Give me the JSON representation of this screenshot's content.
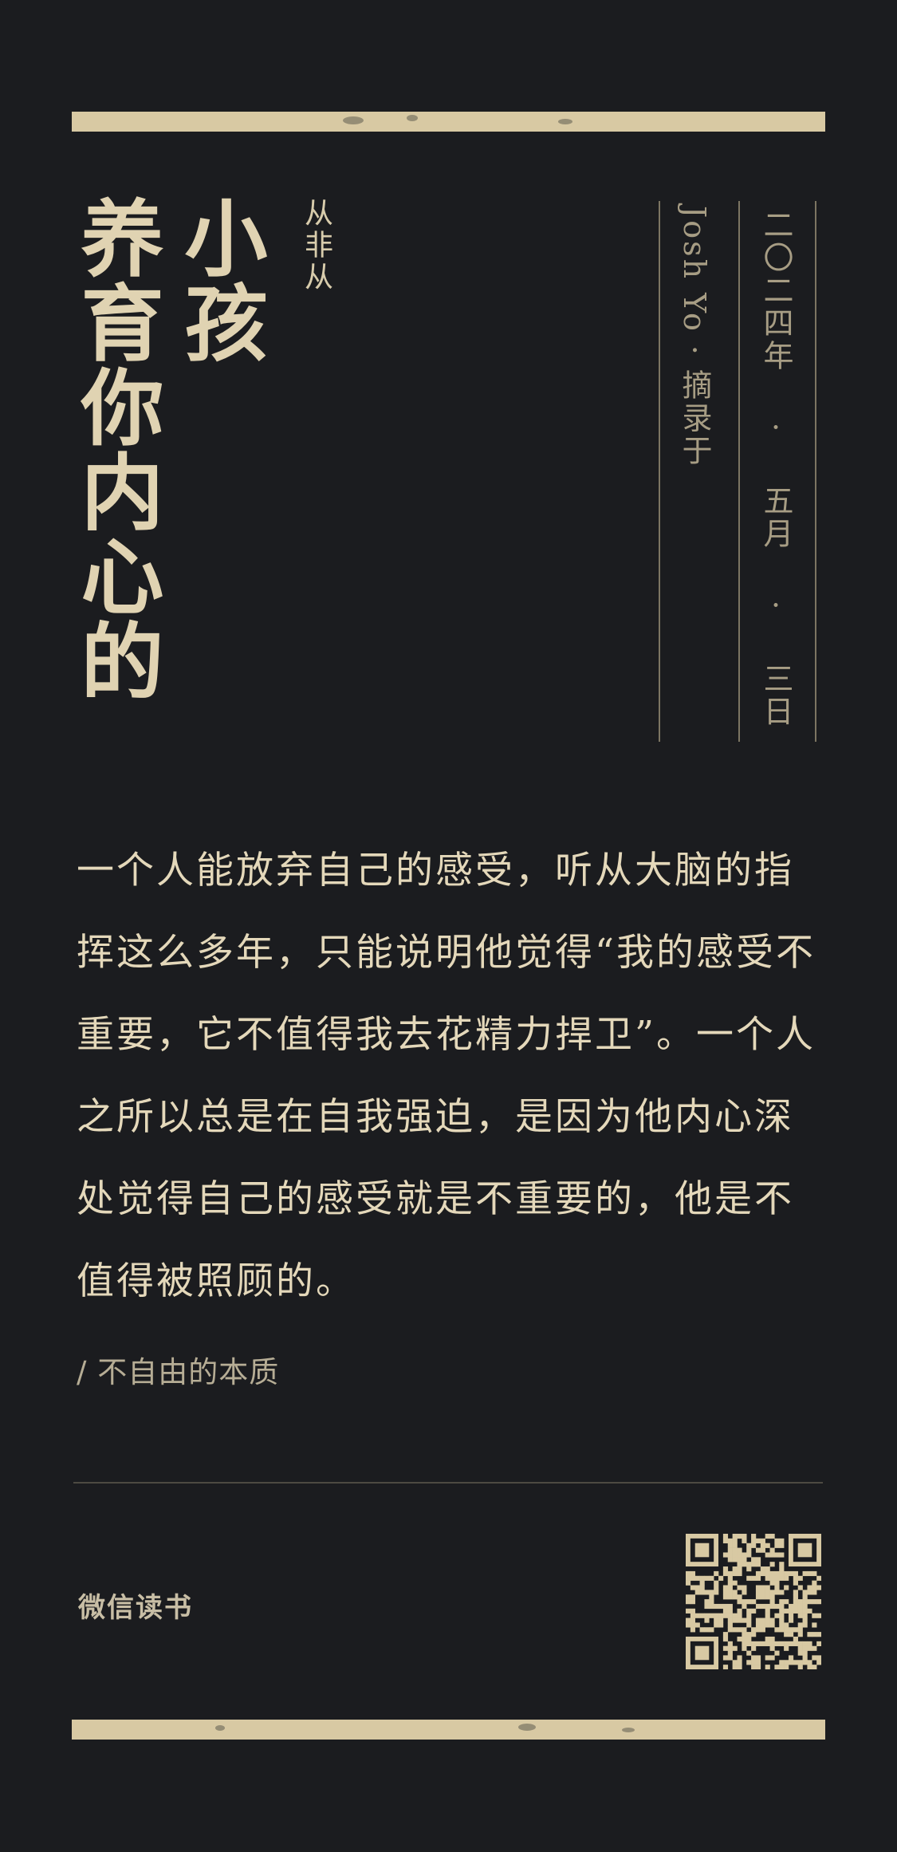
{
  "title": {
    "column_1": "养育你内心的",
    "column_2": "小孩"
  },
  "author": "从非从",
  "signature": "Josh Yo · 摘录于",
  "date": "二〇二四年 · 五月 · 三日",
  "quote": "一个人能放弃自己的感受，听从大脑的指挥这么多年，只能说明他觉得“我的感受不重要，它不值得我去花精力捍卫”。一个人之所以总是在自我强迫，是因为他内心深处觉得自己的感受就是不重要的，他是不值得被照顾的。",
  "source": "/ 不自由的本质",
  "brand": "微信读书",
  "colors": {
    "background": "#1b1c1f",
    "accent": "#d8c9a3",
    "text": "#e4d8ba"
  },
  "icons": {
    "qr": "qr-code-icon"
  }
}
